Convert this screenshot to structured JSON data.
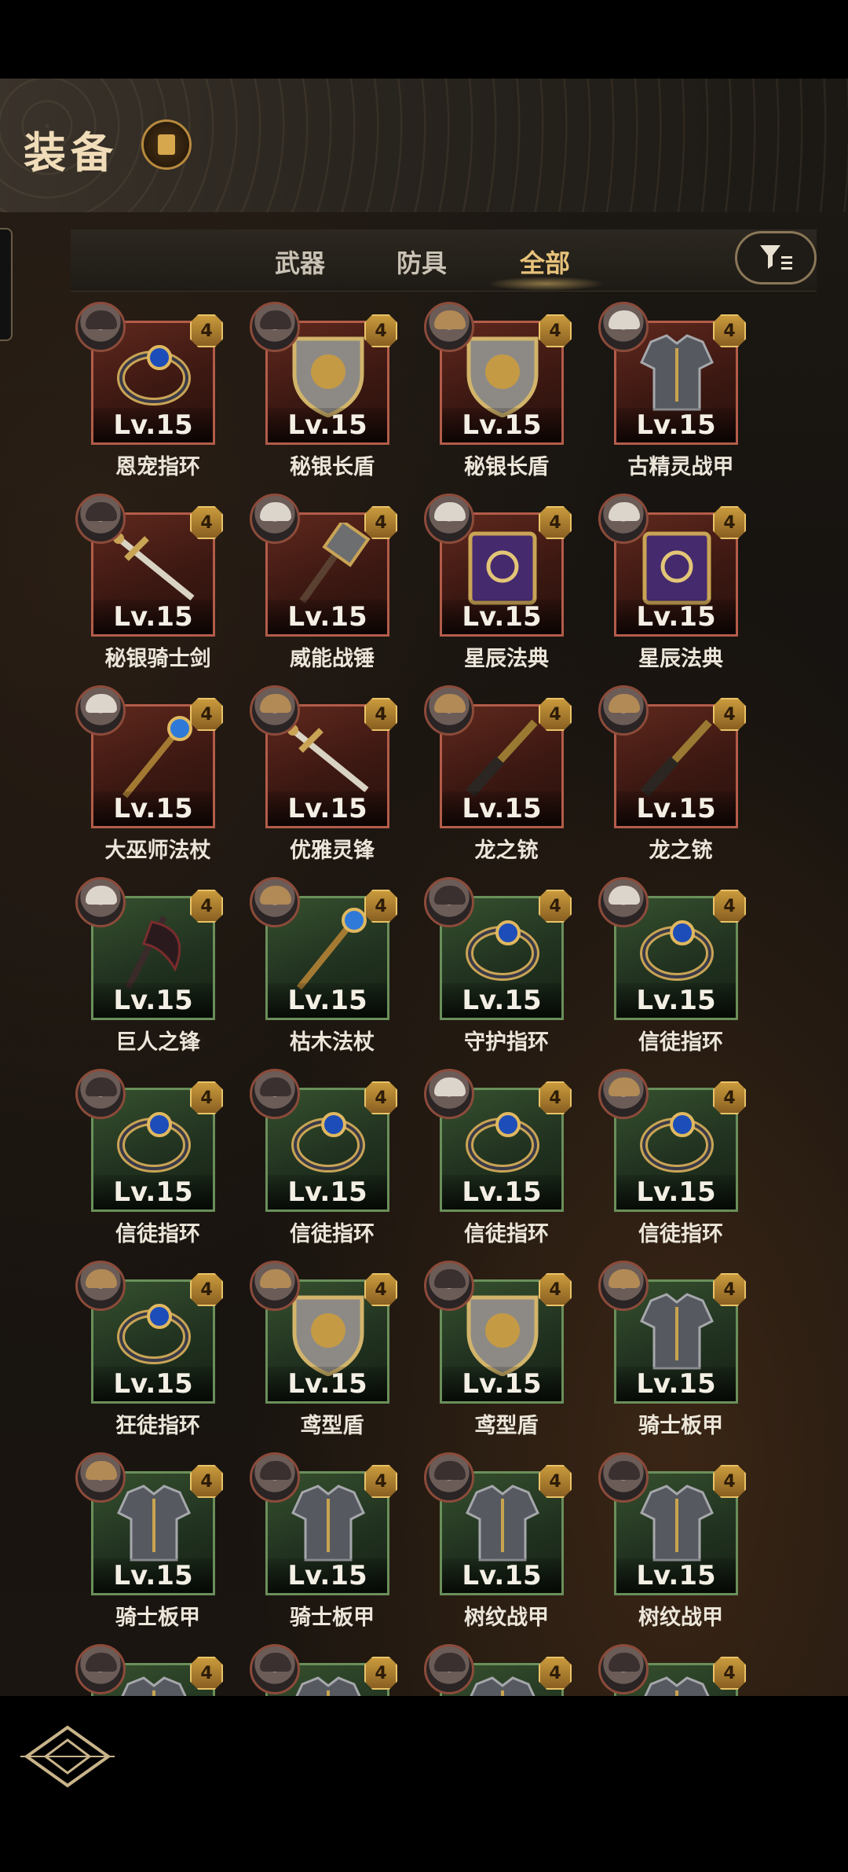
{
  "header": {
    "title": "装备"
  },
  "tabs": [
    {
      "label": "武器",
      "active": false
    },
    {
      "label": "防具",
      "active": false
    },
    {
      "label": "全部",
      "active": true
    }
  ],
  "colors": {
    "accent": "#e6c27a",
    "rare_red": "#b35c49",
    "common_green": "#6a8f5a",
    "rank_gold": "#c99a3c"
  },
  "items": [
    {
      "name": "恩宠指环",
      "level": "Lv.15",
      "rank": "4",
      "frame": "red",
      "icon": "ring-icon"
    },
    {
      "name": "秘银长盾",
      "level": "Lv.15",
      "rank": "4",
      "frame": "red",
      "icon": "shield-icon"
    },
    {
      "name": "秘银长盾",
      "level": "Lv.15",
      "rank": "4",
      "frame": "red",
      "icon": "shield-icon"
    },
    {
      "name": "古精灵战甲",
      "level": "Lv.15",
      "rank": "4",
      "frame": "red",
      "icon": "armor-icon"
    },
    {
      "name": "秘银骑士剑",
      "level": "Lv.15",
      "rank": "4",
      "frame": "red",
      "icon": "sword-icon"
    },
    {
      "name": "威能战锤",
      "level": "Lv.15",
      "rank": "4",
      "frame": "red",
      "icon": "hammer-icon"
    },
    {
      "name": "星辰法典",
      "level": "Lv.15",
      "rank": "4",
      "frame": "red",
      "icon": "book-icon"
    },
    {
      "name": "星辰法典",
      "level": "Lv.15",
      "rank": "4",
      "frame": "red",
      "icon": "book-icon"
    },
    {
      "name": "大巫师法杖",
      "level": "Lv.15",
      "rank": "4",
      "frame": "red",
      "icon": "staff-icon"
    },
    {
      "name": "优雅灵锋",
      "level": "Lv.15",
      "rank": "4",
      "frame": "red",
      "icon": "sword-icon"
    },
    {
      "name": "龙之铳",
      "level": "Lv.15",
      "rank": "4",
      "frame": "red",
      "icon": "gun-icon"
    },
    {
      "name": "龙之铳",
      "level": "Lv.15",
      "rank": "4",
      "frame": "red",
      "icon": "gun-icon"
    },
    {
      "name": "巨人之锋",
      "level": "Lv.15",
      "rank": "4",
      "frame": "green",
      "icon": "axe-icon"
    },
    {
      "name": "枯木法杖",
      "level": "Lv.15",
      "rank": "4",
      "frame": "green",
      "icon": "staff-icon"
    },
    {
      "name": "守护指环",
      "level": "Lv.15",
      "rank": "4",
      "frame": "green",
      "icon": "ring-icon"
    },
    {
      "name": "信徒指环",
      "level": "Lv.15",
      "rank": "4",
      "frame": "green",
      "icon": "ring-icon"
    },
    {
      "name": "信徒指环",
      "level": "Lv.15",
      "rank": "4",
      "frame": "green",
      "icon": "ring-icon"
    },
    {
      "name": "信徒指环",
      "level": "Lv.15",
      "rank": "4",
      "frame": "green",
      "icon": "ring-icon"
    },
    {
      "name": "信徒指环",
      "level": "Lv.15",
      "rank": "4",
      "frame": "green",
      "icon": "ring-icon"
    },
    {
      "name": "信徒指环",
      "level": "Lv.15",
      "rank": "4",
      "frame": "green",
      "icon": "ring-icon"
    },
    {
      "name": "狂徒指环",
      "level": "Lv.15",
      "rank": "4",
      "frame": "green",
      "icon": "ring-icon"
    },
    {
      "name": "鸢型盾",
      "level": "Lv.15",
      "rank": "4",
      "frame": "green",
      "icon": "shield-icon"
    },
    {
      "name": "鸢型盾",
      "level": "Lv.15",
      "rank": "4",
      "frame": "green",
      "icon": "shield-icon"
    },
    {
      "name": "骑士板甲",
      "level": "Lv.15",
      "rank": "4",
      "frame": "green",
      "icon": "armor-icon"
    },
    {
      "name": "骑士板甲",
      "level": "Lv.15",
      "rank": "4",
      "frame": "green",
      "icon": "armor-icon"
    },
    {
      "name": "骑士板甲",
      "level": "Lv.15",
      "rank": "4",
      "frame": "green",
      "icon": "armor-icon"
    },
    {
      "name": "树纹战甲",
      "level": "Lv.15",
      "rank": "4",
      "frame": "green",
      "icon": "armor-icon"
    },
    {
      "name": "树纹战甲",
      "level": "Lv.15",
      "rank": "4",
      "frame": "green",
      "icon": "armor-icon"
    },
    {
      "name": "",
      "level": "",
      "rank": "4",
      "frame": "green",
      "icon": "armor-icon"
    },
    {
      "name": "",
      "level": "",
      "rank": "4",
      "frame": "green",
      "icon": "armor-icon"
    },
    {
      "name": "",
      "level": "",
      "rank": "4",
      "frame": "green",
      "icon": "armor-icon"
    },
    {
      "name": "",
      "level": "",
      "rank": "4",
      "frame": "green",
      "icon": "armor-icon"
    }
  ],
  "avatars": [
    "dark",
    "dark",
    "blond",
    "light",
    "dark",
    "light",
    "light",
    "light",
    "light",
    "blond",
    "blond",
    "blond",
    "light",
    "blond",
    "dark",
    "light",
    "dark",
    "dark",
    "light",
    "blond",
    "blond",
    "blond",
    "dark",
    "blond",
    "blond",
    "dark",
    "dark",
    "dark",
    "dark",
    "dark",
    "dark",
    "dark"
  ]
}
